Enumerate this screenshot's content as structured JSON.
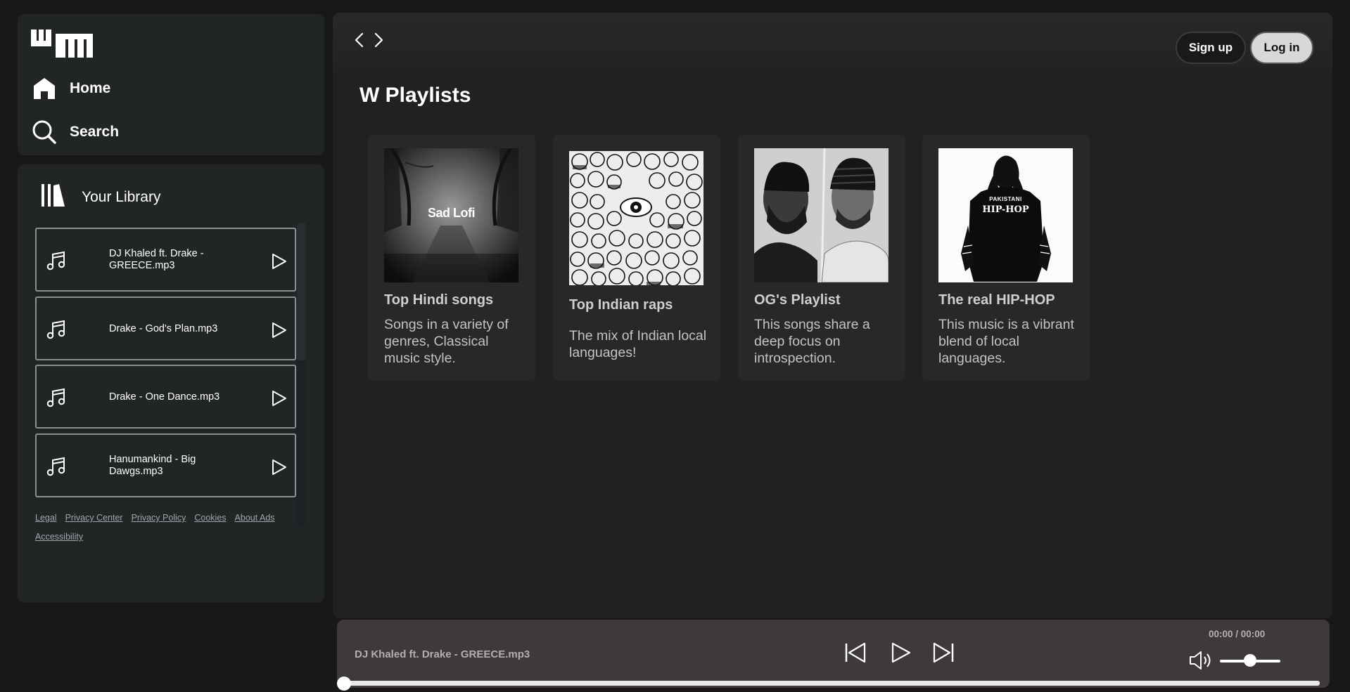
{
  "nav": {
    "home_label": "Home",
    "search_label": "Search"
  },
  "library": {
    "title": "Your Library",
    "songs": [
      {
        "title": "DJ Khaled ft. Drake - GREECE.mp3"
      },
      {
        "title": "Drake - God's Plan.mp3"
      },
      {
        "title": "Drake - One Dance.mp3"
      },
      {
        "title": "Hanumankind - Big Dawgs.mp3"
      }
    ],
    "footer_links": [
      "Legal",
      "Privacy Center",
      "Privacy Policy",
      "Cookies",
      "About Ads",
      "Accessibility"
    ]
  },
  "header": {
    "signup_label": "Sign up",
    "login_label": "Log in"
  },
  "main": {
    "section_title": "W Playlists",
    "cards": [
      {
        "title": "Top Hindi songs",
        "description": "Songs in a variety of genres, Classical music style.",
        "art_text": "Sad Lofi"
      },
      {
        "title": "Top Indian raps",
        "description": "The mix of Indian local languages!"
      },
      {
        "title": "OG's Playlist",
        "description": "This songs share a deep focus on introspection."
      },
      {
        "title": "The real HIP-HOP",
        "description": "This music is a vibrant blend of local languages.",
        "art_text_line1": "PAKISTANI",
        "art_text_line2": "HIP-HOP"
      }
    ]
  },
  "player": {
    "now_playing": "DJ Khaled ft. Drake - GREECE.mp3",
    "time": "00:00 / 00:00",
    "volume": 0.5,
    "progress": 0
  },
  "icons": {
    "logo": "wm-logo",
    "home": "home-icon",
    "search": "search-icon",
    "library": "library-icon",
    "note": "music-note-icon",
    "play": "play-icon",
    "prev": "previous-icon",
    "next": "next-icon",
    "volume": "volume-icon",
    "back": "chevron-left-icon",
    "forward": "chevron-right-icon"
  },
  "colors": {
    "background": "#1a1717",
    "panel": "#222526",
    "main": "#212121",
    "card": "#282828",
    "player": "#3f3a3a"
  }
}
